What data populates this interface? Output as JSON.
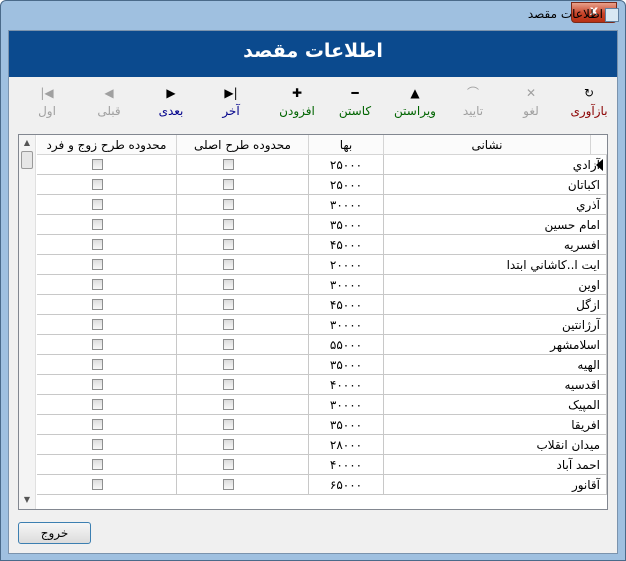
{
  "window": {
    "title": "اطلاعات مقصد",
    "close_glyph": "x"
  },
  "header": {
    "title": "اطلاعات مقصد"
  },
  "toolbar": [
    {
      "id": "refresh",
      "label": "بازآوری",
      "icon": "↻",
      "enabled": true,
      "color": "#8b0000"
    },
    {
      "id": "cancel",
      "label": "لغو",
      "icon": "✕",
      "enabled": false,
      "color": "#a0a0a0"
    },
    {
      "id": "confirm",
      "label": "تایید",
      "icon": "⌒",
      "enabled": false,
      "color": "#a0a0a0"
    },
    {
      "id": "edit",
      "label": "ویراستن",
      "icon": "▲",
      "enabled": true,
      "color": "#006400"
    },
    {
      "id": "delete",
      "label": "کاستن",
      "icon": "━",
      "enabled": true,
      "color": "#006400"
    },
    {
      "id": "add",
      "label": "افزودن",
      "icon": "✚",
      "enabled": true,
      "color": "#006400"
    },
    {
      "id": "last",
      "label": "آخر",
      "icon": "▶|",
      "enabled": true,
      "color": "#00008b"
    },
    {
      "id": "next",
      "label": "بعدی",
      "icon": "▶",
      "enabled": true,
      "color": "#00008b"
    },
    {
      "id": "prev",
      "label": "قبلی",
      "icon": "◀",
      "enabled": false,
      "color": "#a0a0a0"
    },
    {
      "id": "first",
      "label": "اول",
      "icon": "|◀",
      "enabled": false,
      "color": "#a0a0a0"
    }
  ],
  "grid": {
    "columns": [
      "نشانی",
      "بها",
      "محدوده طرح اصلی",
      "محدوده طرح زوج و فرد"
    ],
    "rows": [
      {
        "name": "آزادي",
        "price": "۲۵۰۰۰",
        "main_zone": false,
        "odd_even_zone": false
      },
      {
        "name": "اكباتان",
        "price": "۲۵۰۰۰",
        "main_zone": false,
        "odd_even_zone": false
      },
      {
        "name": "آذري",
        "price": "۳۰۰۰۰",
        "main_zone": false,
        "odd_even_zone": false
      },
      {
        "name": "امام حسين",
        "price": "۳۵۰۰۰",
        "main_zone": false,
        "odd_even_zone": false
      },
      {
        "name": "افسريه",
        "price": "۴۵۰۰۰",
        "main_zone": false,
        "odd_even_zone": false
      },
      {
        "name": "ايت ا..كاشاني ابتدا",
        "price": "۲۰۰۰۰",
        "main_zone": false,
        "odd_even_zone": false
      },
      {
        "name": "اوين",
        "price": "۳۰۰۰۰",
        "main_zone": false,
        "odd_even_zone": false
      },
      {
        "name": "ازگل",
        "price": "۴۵۰۰۰",
        "main_zone": false,
        "odd_even_zone": false
      },
      {
        "name": "آرژانتين",
        "price": "۳۰۰۰۰",
        "main_zone": false,
        "odd_even_zone": false
      },
      {
        "name": "اسلامشهر",
        "price": "۵۵۰۰۰",
        "main_zone": false,
        "odd_even_zone": false
      },
      {
        "name": "الهيه",
        "price": "۳۵۰۰۰",
        "main_zone": false,
        "odd_even_zone": false
      },
      {
        "name": "اقدسيه",
        "price": "۴۰۰۰۰",
        "main_zone": false,
        "odd_even_zone": false
      },
      {
        "name": "المپيک",
        "price": "۳۰۰۰۰",
        "main_zone": false,
        "odd_even_zone": false
      },
      {
        "name": "افريقا",
        "price": "۳۵۰۰۰",
        "main_zone": false,
        "odd_even_zone": false
      },
      {
        "name": "ميدان انقلاب",
        "price": "۲۸۰۰۰",
        "main_zone": false,
        "odd_even_zone": false
      },
      {
        "name": "احمد آباد",
        "price": "۴۰۰۰۰",
        "main_zone": false,
        "odd_even_zone": false
      },
      {
        "name": "آقانور",
        "price": "۶۵۰۰۰",
        "main_zone": false,
        "odd_even_zone": false
      }
    ],
    "current_row_index": 0,
    "scroll_up_glyph": "▲",
    "scroll_down_glyph": "▼"
  },
  "footer": {
    "exit_label": "خروج"
  }
}
